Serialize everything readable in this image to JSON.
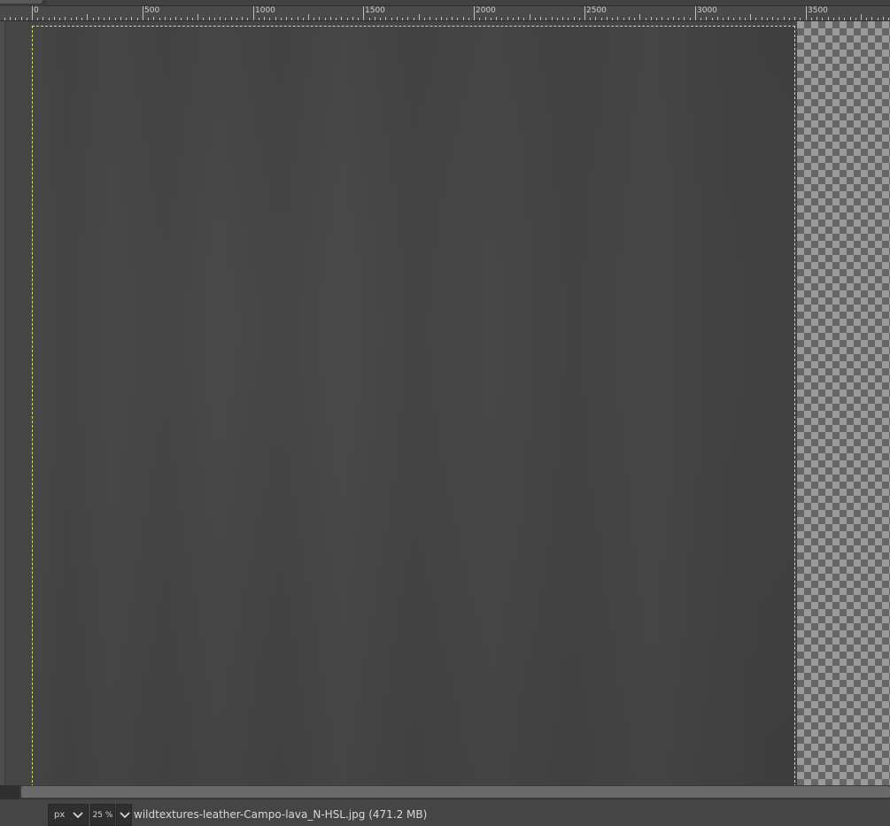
{
  "ruler": {
    "ticks": [
      "0",
      "500",
      "1000",
      "1500",
      "2000",
      "2500",
      "3000",
      "3500"
    ]
  },
  "canvas": {
    "image_fill": "#434343",
    "boundary_color": "#e0e060"
  },
  "status_bar": {
    "unit": "px",
    "zoom": "25 %",
    "file_info": "wildtextures-leather-Campo-lava_N-HSL.jpg (471.2 MB)"
  },
  "icons": {
    "unit_dropdown": "chevron-down-icon",
    "zoom_dropdown": "chevron-down-icon"
  }
}
